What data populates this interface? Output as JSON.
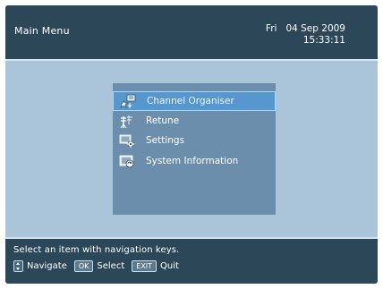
{
  "header": {
    "title": "Main Menu",
    "date": "Fri   04 Sep 2009",
    "time": "15:33:11"
  },
  "menu": {
    "selected_index": 0,
    "items": [
      {
        "label": "Channel Organiser",
        "icon": "channel-organiser-icon"
      },
      {
        "label": "Retune",
        "icon": "antenna-icon"
      },
      {
        "label": "Settings",
        "icon": "settings-icon"
      },
      {
        "label": "System Information",
        "icon": "system-information-icon"
      }
    ]
  },
  "footer": {
    "hint": "Select an item with navigation keys.",
    "navigate_label": "Navigate",
    "ok_key": "OK",
    "select_label": "Select",
    "exit_key": "EXIT",
    "quit_label": "Quit"
  },
  "colors": {
    "header_bg": "#2b4758",
    "body_bg": "#aac4da",
    "panel_bg": "#6a8eab",
    "highlight": "#5797cf"
  }
}
